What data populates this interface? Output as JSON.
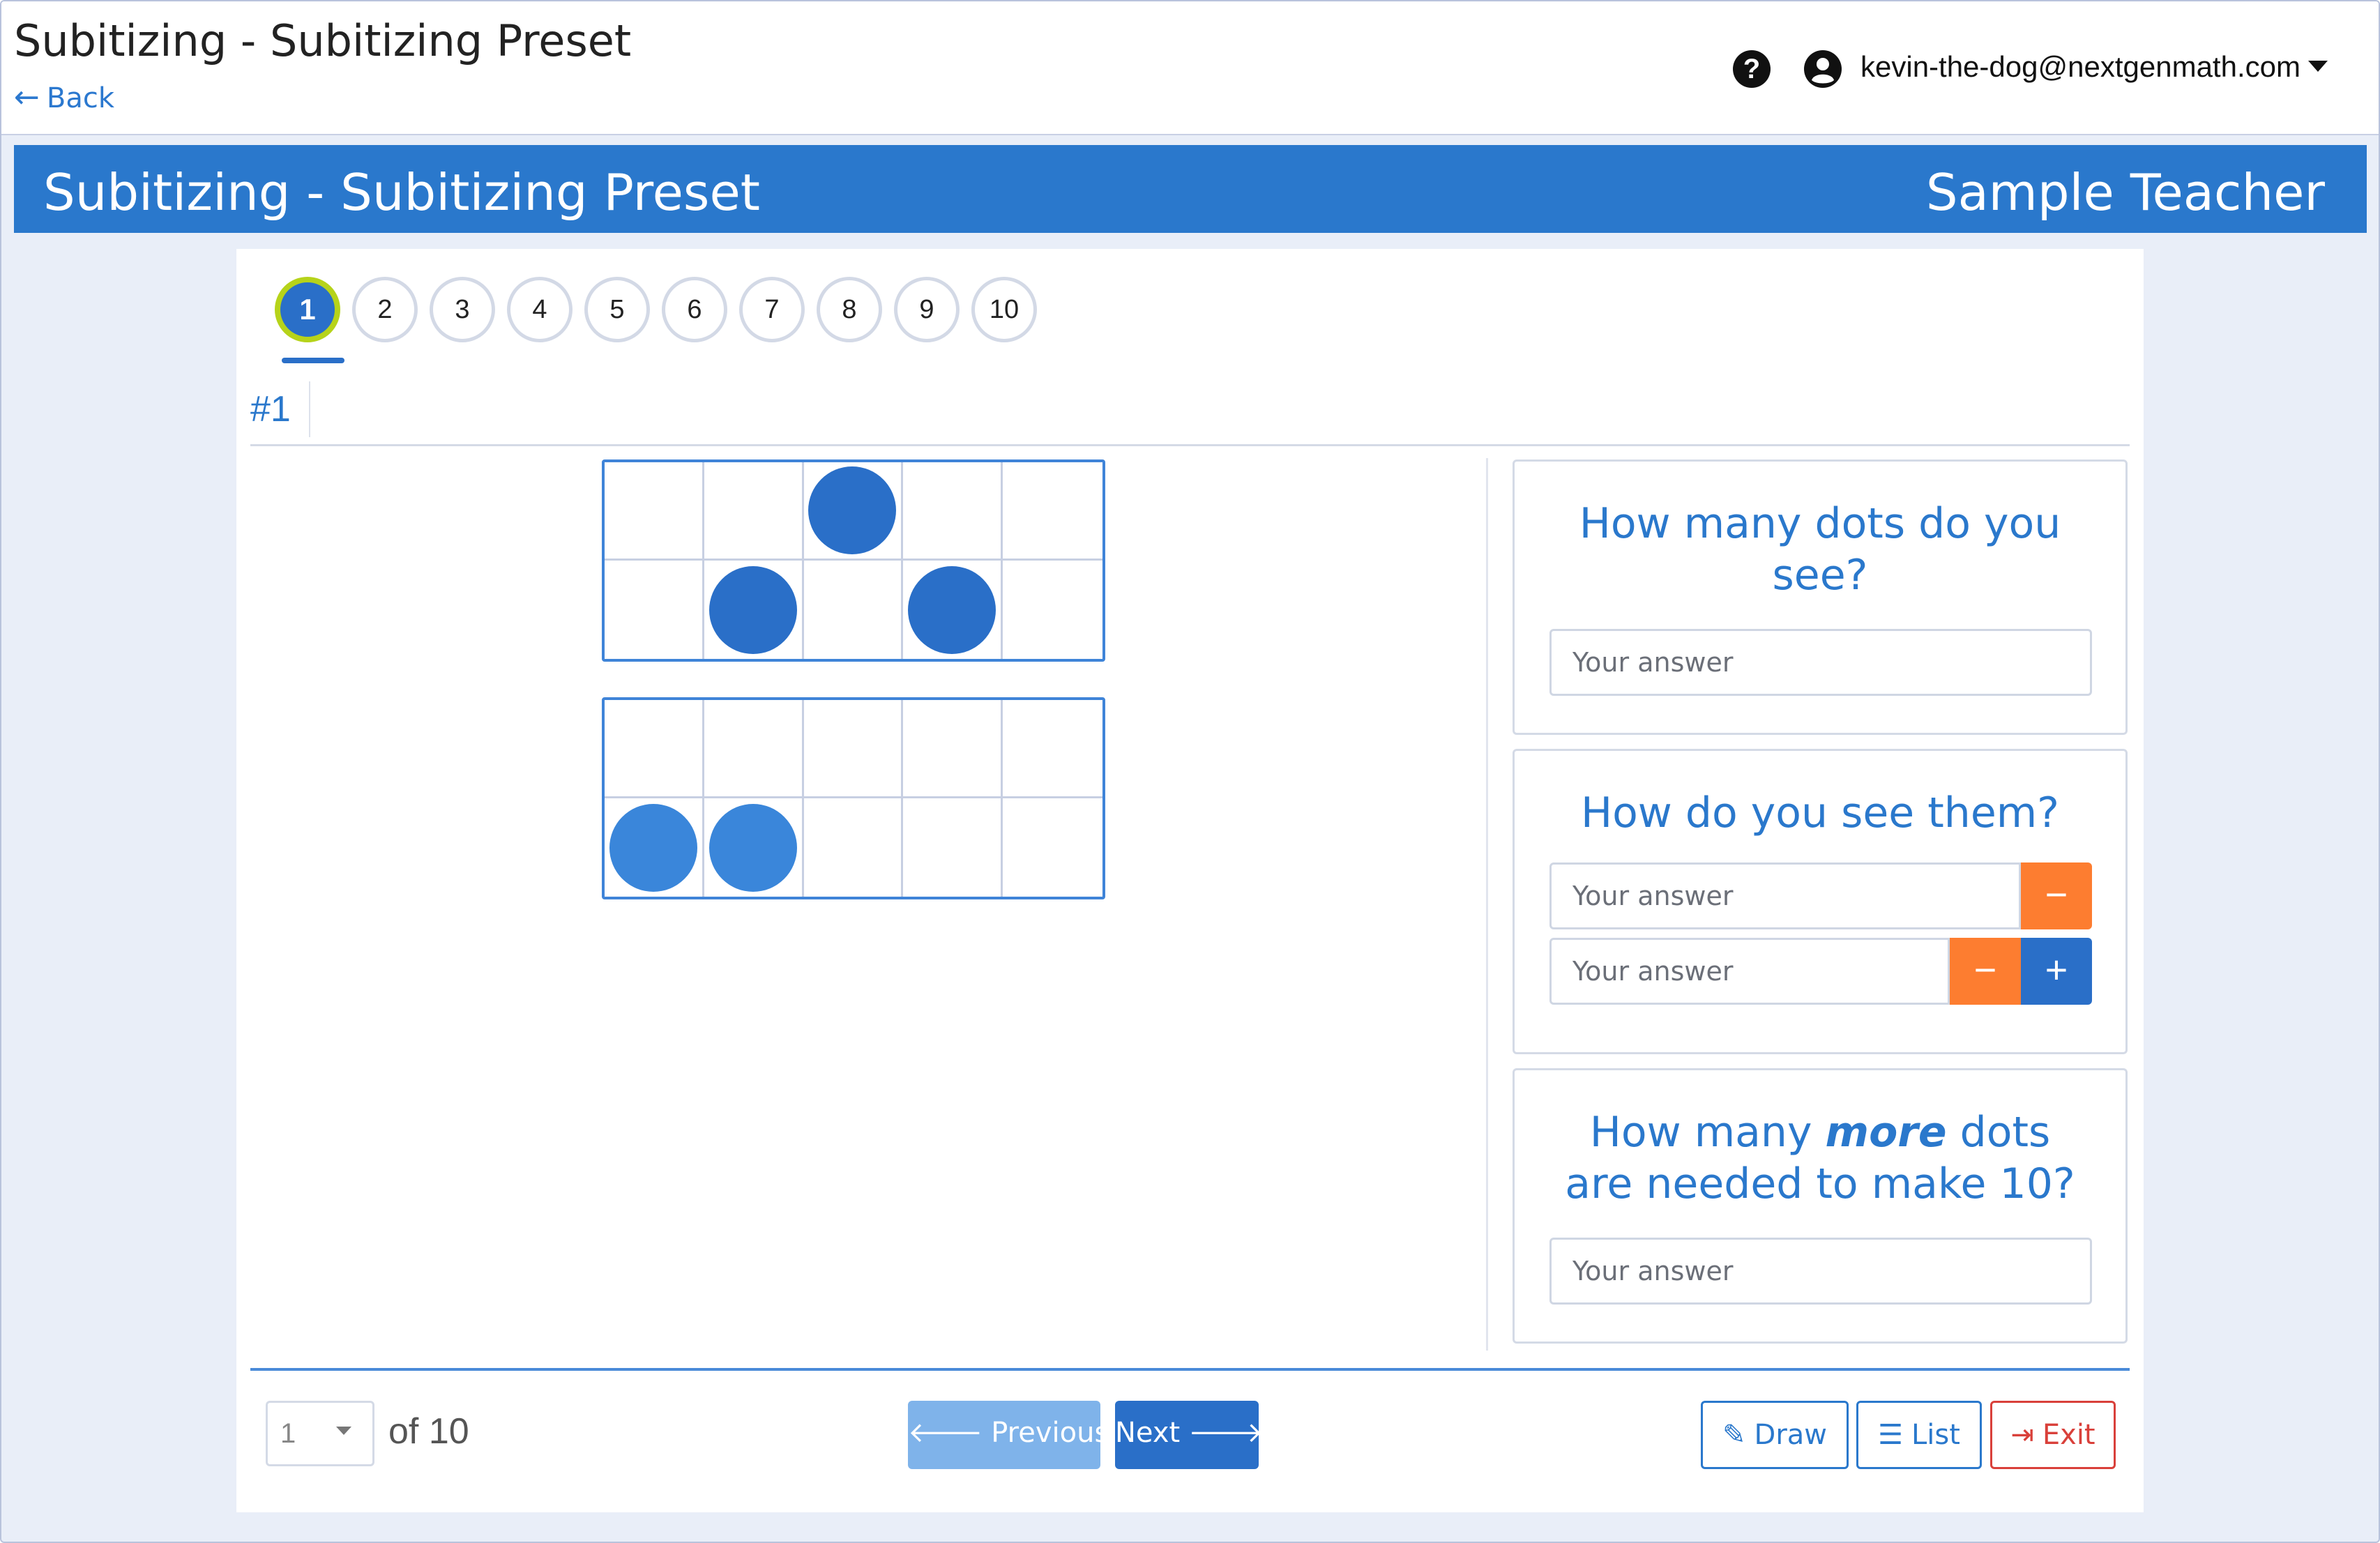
{
  "header": {
    "app_title": "Subitizing - Subitizing Preset",
    "back_label": "Back",
    "help_icon": "?",
    "user_email": "kevin-the-dog@nextgenmath.com"
  },
  "banner": {
    "title": "Subitizing - Subitizing Preset",
    "teacher": "Sample Teacher"
  },
  "question_nav": {
    "items": [
      "1",
      "2",
      "3",
      "4",
      "5",
      "6",
      "7",
      "8",
      "9",
      "10"
    ],
    "active": "1",
    "current_label": "#1"
  },
  "ten_frames": [
    {
      "filled_cells": [
        3,
        7,
        9
      ]
    },
    {
      "filled_cells": [
        6,
        7
      ]
    }
  ],
  "questions": {
    "q1": {
      "text": "How many dots do you see?",
      "placeholder": "Your answer"
    },
    "q2": {
      "text": "How do you see them?",
      "placeholder_1": "Your answer",
      "placeholder_2": "Your answer",
      "minus": "−",
      "plus": "+"
    },
    "q3": {
      "text_before": "How many ",
      "text_em": "more",
      "text_after": " dots are needed to make 10?",
      "placeholder": "Your answer"
    }
  },
  "footer": {
    "page_value": "1",
    "of_total": "of 10",
    "previous_label": "Previous",
    "next_label": "Next",
    "draw_label": "Draw",
    "list_label": "List",
    "exit_label": "Exit"
  },
  "colors": {
    "brand_blue": "#2a78cc",
    "dot_blue": "#2a6fc8",
    "active_ring": "#b6d31a",
    "minus_orange": "#fd7d30",
    "exit_red": "#d9403a"
  }
}
